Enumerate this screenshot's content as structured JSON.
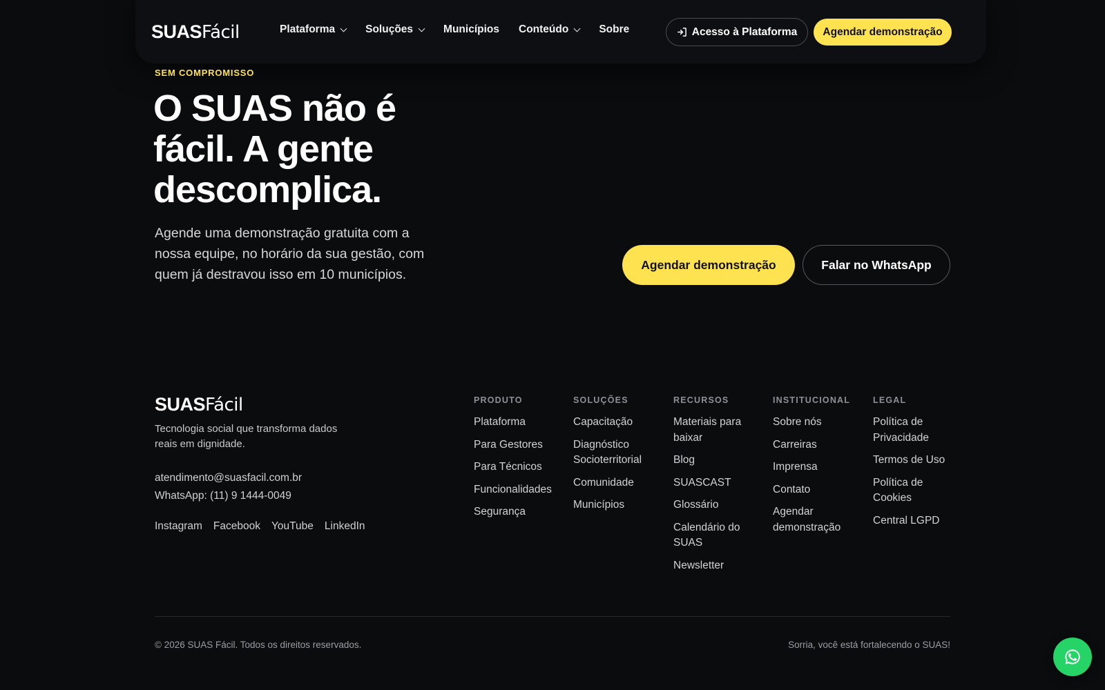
{
  "brand": {
    "bold": "SUAS",
    "light": "Fácil"
  },
  "colors": {
    "accent": "#ffe24f",
    "background": "#0b0c0e",
    "whatsapp": "#25d366"
  },
  "nav": {
    "items": [
      {
        "label": "Plataforma",
        "dropdown": true
      },
      {
        "label": "Soluções",
        "dropdown": true
      },
      {
        "label": "Municípios",
        "dropdown": false
      },
      {
        "label": "Conteúdo",
        "dropdown": true
      },
      {
        "label": "Sobre",
        "dropdown": false
      }
    ],
    "access_label": "Acesso à Plataforma",
    "access_icon": "login-icon",
    "demo_label": "Agendar demonstração"
  },
  "hero": {
    "eyebrow": "SEM COMPROMISSO",
    "title": "O SUAS não é fácil. A gente descomplica.",
    "subtitle": "Agende uma demonstração gratuita com a nossa equipe, no horário da sua gestão, com quem já destravou isso em 10 municípios.",
    "primary_cta": "Agendar demonstração",
    "secondary_cta": "Falar no WhatsApp"
  },
  "footer": {
    "tagline": "Tecnologia social que transforma dados reais em dignidade.",
    "email": "atendimento@suasfacil.com.br",
    "whatsapp": "WhatsApp: (11) 9 1444-0049",
    "social": [
      "Instagram",
      "Facebook",
      "YouTube",
      "LinkedIn"
    ],
    "columns": [
      {
        "title": "PRODUTO",
        "links": [
          "Plataforma",
          "Para Gestores",
          "Para Técnicos",
          "Funcionalidades",
          "Segurança"
        ]
      },
      {
        "title": "SOLUÇÕES",
        "links": [
          "Capacitação",
          "Diagnóstico Socioterritorial",
          "Comunidade",
          "Municípios"
        ]
      },
      {
        "title": "RECURSOS",
        "links": [
          "Materiais para baixar",
          "Blog",
          "SUASCAST",
          "Glossário",
          "Calendário do SUAS",
          "Newsletter"
        ]
      },
      {
        "title": "INSTITUCIONAL",
        "links": [
          "Sobre nós",
          "Carreiras",
          "Imprensa",
          "Contato",
          "Agendar demonstração"
        ]
      },
      {
        "title": "LEGAL",
        "links": [
          "Política de Privacidade",
          "Termos de Uso",
          "Política de Cookies",
          "Central LGPD"
        ]
      }
    ],
    "copyright": "© 2026 SUAS Fácil. Todos os direitos reservados.",
    "slogan": "Sorria, você está fortalecendo o SUAS!"
  },
  "fab": {
    "icon": "whatsapp-icon"
  }
}
